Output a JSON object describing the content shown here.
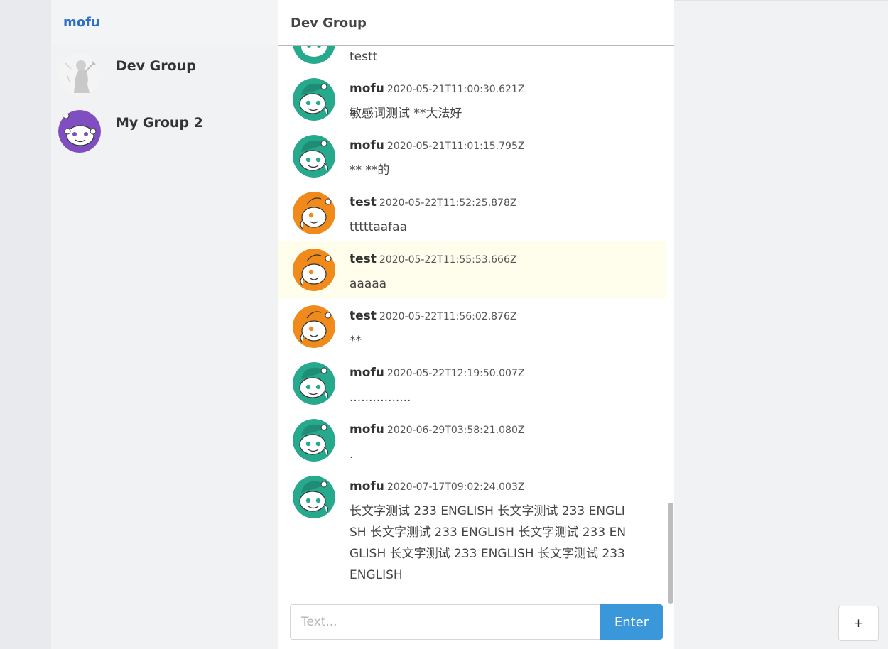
{
  "sidebar": {
    "brand": "mofu",
    "groups": [
      {
        "name": "Dev Group",
        "avatar_icon": "sketch-avatar-icon"
      },
      {
        "name": "My Group 2",
        "avatar_icon": "reddit-alien-purple-icon"
      }
    ]
  },
  "main": {
    "title": "Dev Group",
    "messages": [
      {
        "author": "",
        "timestamp": "",
        "text": "testt",
        "avatar_color": "#26a98d"
      },
      {
        "author": "mofu",
        "timestamp": "2020-05-21T11:00:30.621Z",
        "text": "敏感词测试 **大法好",
        "avatar_color": "#26a98d"
      },
      {
        "author": "mofu",
        "timestamp": "2020-05-21T11:01:15.795Z",
        "text": "** **的",
        "avatar_color": "#26a98d"
      },
      {
        "author": "test",
        "timestamp": "2020-05-22T11:52:25.878Z",
        "text": "tttttaafaa",
        "avatar_color": "#f08a1a"
      },
      {
        "author": "test",
        "timestamp": "2020-05-22T11:55:53.666Z",
        "text": "aaaaa",
        "avatar_color": "#f08a1a",
        "highlighted": true
      },
      {
        "author": "test",
        "timestamp": "2020-05-22T11:56:02.876Z",
        "text": "**",
        "avatar_color": "#f08a1a"
      },
      {
        "author": "mofu",
        "timestamp": "2020-05-22T12:19:50.007Z",
        "text": "................",
        "avatar_color": "#26a98d"
      },
      {
        "author": "mofu",
        "timestamp": "2020-06-29T03:58:21.080Z",
        "text": ".",
        "avatar_color": "#26a98d"
      },
      {
        "author": "mofu",
        "timestamp": "2020-07-17T09:02:24.003Z",
        "text": "长文字测试 233 ENGLISH 长文字测试 233 ENGLISH 长文字测试 233 ENGLISH 长文字测试 233 ENGLISH 长文字测试 233 ENGLISH 长文字测试 233 ENGLISH",
        "avatar_color": "#26a98d"
      }
    ],
    "composer": {
      "placeholder": "Text...",
      "value": "",
      "enter_label": "Enter"
    }
  },
  "add_button_label": "+",
  "colors": {
    "accent": "#3a97d9",
    "brand": "#2f6fc8",
    "highlight": "#fffdeb"
  }
}
